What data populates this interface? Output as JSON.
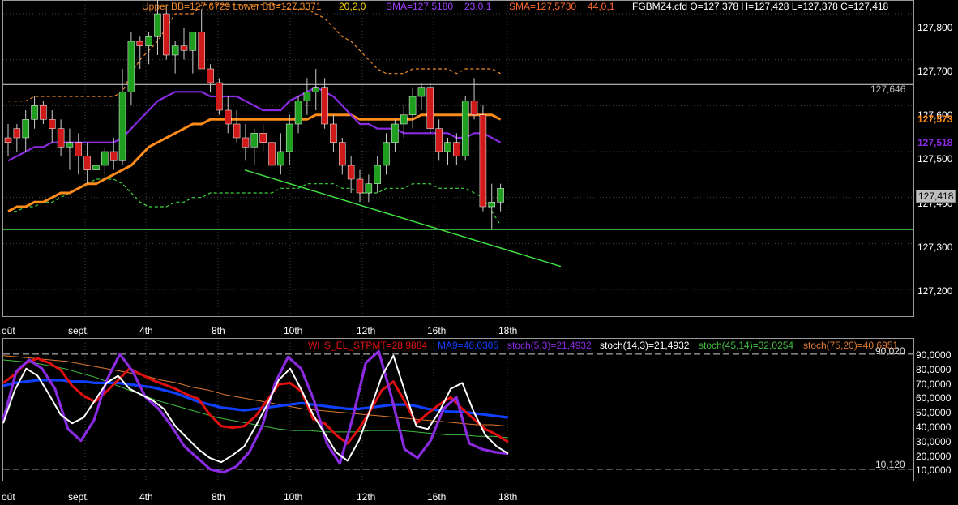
{
  "colors": {
    "background": "#000000",
    "candle_up": "#1f9e1f",
    "candle_down": "#d01a1a",
    "wick": "#cccccc",
    "bb_upper": "#f08a2a",
    "bb_lower": "#3fd43f",
    "sma_23": "#8a2be2",
    "sma_44": "#ff8c1a",
    "trendline": "#40e040",
    "hline_upper": "#dcdcdc",
    "hline_lower": "#3fbf3f",
    "osc_red": "#e01010",
    "osc_blue": "#1040ff",
    "osc_white": "#ffffff",
    "osc_purple": "#8a2be2",
    "osc_green": "#3fbf3f",
    "osc_orange": "#e07a30"
  },
  "header": {
    "bb": "Upper BB=127,6729 Lower BB=127,3371",
    "bb_params": "20,2,0",
    "sma1": "SMA=127,5180",
    "sma1_params": "23,0,1",
    "sma2": "SMA=127,5730",
    "sma2_params": "44,0,1",
    "symbol": "FGBMZ4.cfd O=127,378 H=127,428 L=127,378 C=127,418"
  },
  "osc_header": {
    "whs": "WHS_EL_STPMT=28,9884",
    "ma9": "MA9=46,0305",
    "stoch53": "stoch(5,3)=21,4932",
    "stoch143": "stoch(14,3)=21,4932",
    "stoch4514": "stoch(45,14)=32,0254",
    "stoch7520": "stoch(75,20)=40,6951"
  },
  "price_axis": {
    "ticks": [
      "127,800",
      "127,700",
      "127,600",
      "127,500",
      "127,400",
      "127,300",
      "127,200"
    ],
    "badges": {
      "hline": "127,646",
      "sma44": "127,573",
      "sma23": "127,518",
      "close": "127,418"
    }
  },
  "osc_axis": {
    "ticks": [
      "90,0000",
      "80,0000",
      "70,0000",
      "60,0000",
      "50,0000",
      "40,0000",
      "30,0000",
      "20,0000",
      "10,0000"
    ],
    "upper_level": "90,020",
    "lower_level": "10,120"
  },
  "x_labels": [
    "oût",
    "sept.",
    "4th",
    "8th",
    "10th",
    "12th",
    "16th",
    "18th"
  ],
  "chart_data": [
    {
      "type": "candlestick",
      "title": "FGBMZ4.cfd",
      "ylim": [
        127.14,
        127.83
      ],
      "hlines": [
        127.646,
        127.33
      ],
      "trendline": [
        [
          0.302,
          127.46
        ],
        [
          0.688,
          127.25
        ]
      ],
      "candles": [
        [
          127.53,
          127.56,
          127.49,
          127.52
        ],
        [
          127.55,
          127.56,
          127.5,
          127.53
        ],
        [
          127.53,
          127.59,
          127.5,
          127.57
        ],
        [
          127.57,
          127.62,
          127.55,
          127.6
        ],
        [
          127.6,
          127.61,
          127.56,
          127.57
        ],
        [
          127.57,
          127.59,
          127.52,
          127.55
        ],
        [
          127.55,
          127.57,
          127.49,
          127.51
        ],
        [
          127.51,
          127.55,
          127.46,
          127.52
        ],
        [
          127.52,
          127.54,
          127.45,
          127.49
        ],
        [
          127.49,
          127.52,
          127.43,
          127.46
        ],
        [
          127.46,
          127.49,
          127.33,
          127.47
        ],
        [
          127.47,
          127.51,
          127.44,
          127.5
        ],
        [
          127.5,
          127.53,
          127.46,
          127.48
        ],
        [
          127.48,
          127.68,
          127.47,
          127.63
        ],
        [
          127.63,
          127.76,
          127.6,
          127.74
        ],
        [
          127.74,
          127.75,
          127.68,
          127.73
        ],
        [
          127.73,
          127.76,
          127.69,
          127.75
        ],
        [
          127.75,
          127.83,
          127.71,
          127.8
        ],
        [
          127.8,
          127.82,
          127.7,
          127.71
        ],
        [
          127.71,
          127.74,
          127.67,
          127.73
        ],
        [
          127.73,
          127.77,
          127.7,
          127.72
        ],
        [
          127.72,
          127.75,
          127.67,
          127.76
        ],
        [
          127.76,
          127.81,
          127.69,
          127.68
        ],
        [
          127.68,
          127.69,
          127.63,
          127.65
        ],
        [
          127.65,
          127.66,
          127.58,
          127.59
        ],
        [
          127.59,
          127.62,
          127.54,
          127.56
        ],
        [
          127.56,
          127.59,
          127.52,
          127.53
        ],
        [
          127.53,
          127.56,
          127.48,
          127.51
        ],
        [
          127.51,
          127.55,
          127.47,
          127.54
        ],
        [
          127.54,
          127.56,
          127.5,
          127.52
        ],
        [
          127.52,
          127.54,
          127.46,
          127.47
        ],
        [
          127.47,
          127.54,
          127.45,
          127.5
        ],
        [
          127.5,
          127.58,
          127.47,
          127.56
        ],
        [
          127.56,
          127.62,
          127.54,
          127.61
        ],
        [
          127.61,
          127.66,
          127.58,
          127.63
        ],
        [
          127.63,
          127.68,
          127.59,
          127.64
        ],
        [
          127.64,
          127.66,
          127.55,
          127.56
        ],
        [
          127.56,
          127.58,
          127.5,
          127.52
        ],
        [
          127.52,
          127.53,
          127.45,
          127.47
        ],
        [
          127.47,
          127.49,
          127.41,
          127.44
        ],
        [
          127.44,
          127.46,
          127.39,
          127.41
        ],
        [
          127.41,
          127.45,
          127.39,
          127.43
        ],
        [
          127.43,
          127.49,
          127.41,
          127.47
        ],
        [
          127.47,
          127.54,
          127.45,
          127.52
        ],
        [
          127.52,
          127.57,
          127.5,
          127.56
        ],
        [
          127.56,
          127.6,
          127.53,
          127.58
        ],
        [
          127.58,
          127.64,
          127.55,
          127.62
        ],
        [
          127.62,
          127.65,
          127.59,
          127.64
        ],
        [
          127.64,
          127.65,
          127.54,
          127.55
        ],
        [
          127.55,
          127.57,
          127.48,
          127.5
        ],
        [
          127.5,
          127.53,
          127.47,
          127.52
        ],
        [
          127.52,
          127.54,
          127.47,
          127.49
        ],
        [
          127.49,
          127.62,
          127.48,
          127.61
        ],
        [
          127.61,
          127.66,
          127.57,
          127.58
        ],
        [
          127.58,
          127.6,
          127.37,
          127.38
        ],
        [
          127.38,
          127.43,
          127.33,
          127.39
        ],
        [
          127.39,
          127.43,
          127.37,
          127.42
        ]
      ],
      "series": [
        {
          "key": "bb_upper",
          "values": [
            127.61,
            127.61,
            127.61,
            127.62,
            127.62,
            127.62,
            127.62,
            127.62,
            127.62,
            127.62,
            127.62,
            127.62,
            127.62,
            127.63,
            127.67,
            127.7,
            127.72,
            127.74,
            127.77,
            127.8,
            127.8,
            127.8,
            127.82,
            127.82,
            127.82,
            127.82,
            127.82,
            127.82,
            127.82,
            127.82,
            127.82,
            127.82,
            127.81,
            127.81,
            127.81,
            127.8,
            127.79,
            127.77,
            127.75,
            127.74,
            127.72,
            127.7,
            127.68,
            127.67,
            127.67,
            127.67,
            127.68,
            127.68,
            127.68,
            127.68,
            127.68,
            127.67,
            127.68,
            127.68,
            127.68,
            127.68,
            127.67
          ]
        },
        {
          "key": "bb_lower",
          "values": [
            127.37,
            127.37,
            127.38,
            127.38,
            127.39,
            127.39,
            127.4,
            127.41,
            127.42,
            127.43,
            127.44,
            127.44,
            127.44,
            127.43,
            127.41,
            127.39,
            127.38,
            127.38,
            127.38,
            127.39,
            127.39,
            127.4,
            127.4,
            127.41,
            127.41,
            127.41,
            127.41,
            127.41,
            127.41,
            127.41,
            127.41,
            127.42,
            127.42,
            127.42,
            127.43,
            127.43,
            127.43,
            127.43,
            127.42,
            127.42,
            127.41,
            127.41,
            127.41,
            127.42,
            127.42,
            127.42,
            127.43,
            127.43,
            127.43,
            127.42,
            127.42,
            127.42,
            127.42,
            127.41,
            127.4,
            127.37,
            127.34
          ]
        },
        {
          "key": "sma_44",
          "values": [
            127.37,
            127.38,
            127.38,
            127.39,
            127.39,
            127.4,
            127.41,
            127.41,
            127.42,
            127.43,
            127.43,
            127.44,
            127.45,
            127.46,
            127.47,
            127.49,
            127.51,
            127.52,
            127.53,
            127.54,
            127.55,
            127.56,
            127.56,
            127.57,
            127.57,
            127.57,
            127.57,
            127.57,
            127.57,
            127.57,
            127.57,
            127.57,
            127.57,
            127.57,
            127.57,
            127.58,
            127.58,
            127.58,
            127.58,
            127.58,
            127.57,
            127.57,
            127.57,
            127.57,
            127.57,
            127.57,
            127.57,
            127.58,
            127.58,
            127.58,
            127.58,
            127.58,
            127.58,
            127.58,
            127.58,
            127.58,
            127.57
          ]
        },
        {
          "key": "sma_23",
          "values": [
            127.48,
            127.49,
            127.5,
            127.51,
            127.51,
            127.52,
            127.52,
            127.52,
            127.52,
            127.52,
            127.52,
            127.52,
            127.52,
            127.53,
            127.55,
            127.57,
            127.59,
            127.61,
            127.62,
            127.63,
            127.63,
            127.63,
            127.63,
            127.62,
            127.62,
            127.62,
            127.62,
            127.61,
            127.6,
            127.59,
            127.59,
            127.59,
            127.61,
            127.62,
            127.63,
            127.64,
            127.63,
            127.62,
            127.6,
            127.58,
            127.56,
            127.56,
            127.55,
            127.55,
            127.55,
            127.54,
            127.54,
            127.54,
            127.54,
            127.54,
            127.54,
            127.53,
            127.53,
            127.54,
            127.54,
            127.53,
            127.52
          ]
        }
      ]
    },
    {
      "type": "line",
      "title": "WHS_EL_STPMT",
      "ylim": [
        5,
        95
      ],
      "levels": [
        90.02,
        10.12
      ],
      "series": [
        {
          "key": "osc_red",
          "name": "WHS_EL_STPMT",
          "values": [
            70,
            76,
            84,
            87,
            84,
            79,
            68,
            61,
            57,
            64,
            72,
            80,
            76,
            72,
            69,
            66,
            62,
            59,
            48,
            40,
            39,
            40,
            47,
            58,
            69,
            70,
            64,
            45,
            42,
            34,
            28,
            38,
            51,
            65,
            71,
            57,
            42,
            49,
            55,
            60,
            52,
            45,
            38,
            34,
            29
          ]
        },
        {
          "key": "osc_blue",
          "name": "MA9",
          "values": [
            68,
            70,
            71,
            72,
            72,
            72,
            71,
            71,
            70,
            70,
            70,
            69,
            68,
            67,
            65,
            63,
            60,
            57,
            55,
            53,
            52,
            51,
            52,
            53,
            54,
            55,
            56,
            55,
            54,
            53,
            52,
            52,
            53,
            54,
            55,
            55,
            54,
            52,
            51,
            50,
            50,
            49,
            48,
            47,
            46
          ]
        },
        {
          "key": "osc_white",
          "name": "stoch(5,3)",
          "values": [
            42,
            65,
            80,
            75,
            62,
            48,
            42,
            46,
            58,
            70,
            75,
            66,
            62,
            58,
            52,
            40,
            32,
            24,
            18,
            15,
            20,
            26,
            40,
            55,
            72,
            80,
            65,
            48,
            35,
            22,
            16,
            30,
            52,
            75,
            89,
            64,
            40,
            38,
            50,
            66,
            70,
            50,
            34,
            26,
            21
          ]
        },
        {
          "key": "osc_purple",
          "name": "stoch(14,3)",
          "values": [
            44,
            78,
            86,
            80,
            66,
            38,
            30,
            44,
            72,
            90,
            78,
            60,
            52,
            40,
            26,
            18,
            10,
            8,
            12,
            22,
            40,
            70,
            88,
            80,
            58,
            28,
            14,
            46,
            84,
            92,
            60,
            24,
            18,
            30,
            52,
            60,
            28,
            24,
            22,
            21
          ]
        },
        {
          "key": "osc_green",
          "name": "stoch(45,14)",
          "values": [
            86,
            85,
            84,
            82,
            80,
            77,
            74,
            70,
            66,
            62,
            58,
            55,
            52,
            49,
            46,
            44,
            42,
            40,
            38,
            37,
            37,
            36,
            36,
            36,
            37,
            37,
            37,
            36,
            35,
            34,
            34,
            33,
            33,
            32
          ]
        },
        {
          "key": "osc_orange",
          "name": "stoch(75,20)",
          "values": [
            89,
            88,
            87,
            86,
            85,
            83,
            81,
            79,
            77,
            75,
            72,
            70,
            67,
            65,
            62,
            60,
            58,
            56,
            54,
            52,
            51,
            50,
            49,
            48,
            47,
            46,
            45,
            44,
            43,
            42,
            41,
            41,
            40
          ]
        }
      ]
    }
  ]
}
